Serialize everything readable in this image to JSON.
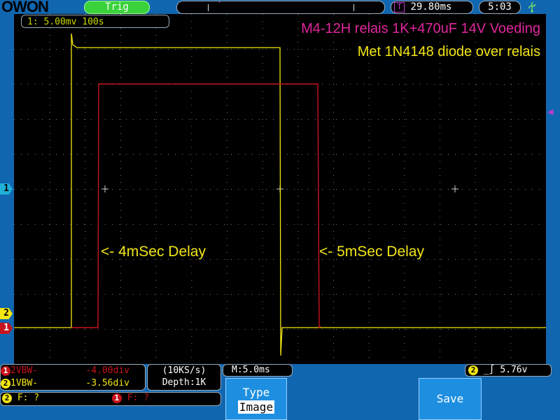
{
  "brand": "OWON",
  "trigger_status": "Trig",
  "trigger_position": "29.80ms",
  "clock": "5:03",
  "channel_info": "1: 5.00mv 100s",
  "title_line1": "M4-12H relais 1K+470uF 14V Voeding",
  "title_line2": "Met 1N4148 diode over relais",
  "annotation_left": "<- 4mSec Delay",
  "annotation_right": "<- 5mSec Delay",
  "markers": {
    "ch1": "1",
    "ch2": "2",
    "ref": "1"
  },
  "vertical": {
    "row1_label": "2VBW-",
    "row1_value": "-4.00div",
    "row1_num": "1",
    "row2_label": "1VBW-",
    "row2_value": "-3.56div",
    "row2_num": "2"
  },
  "sample": {
    "rate": "(10KS/s)",
    "depth": "Depth:1K"
  },
  "timebase": "M:5.0ms",
  "trigger_info": {
    "channel": "2",
    "level": "5.76v"
  },
  "freq": {
    "ch2_num": "2",
    "ch2": "F:  ?",
    "ch1_num": "1",
    "ch1": "F:  ?"
  },
  "menu": {
    "type_label": "Type",
    "type_value": "Image",
    "save_label": "Save"
  },
  "colors": {
    "ch_yellow": "#f2e614",
    "ch_red": "#c8141e",
    "title_magenta": "#e0279e"
  },
  "icons": {
    "usb": "usb-icon",
    "trigger_edge": "rising-edge-icon"
  }
}
